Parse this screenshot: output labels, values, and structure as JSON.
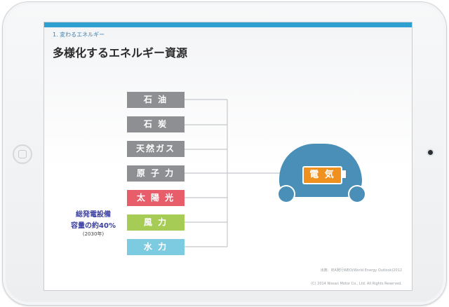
{
  "slide": {
    "section": "1. 変わるエネルギー",
    "title": "多様化するエネルギー資源"
  },
  "energy_sources": [
    {
      "label": "石 油",
      "color": "#8d8f92"
    },
    {
      "label": "石 炭",
      "color": "#8d8f92"
    },
    {
      "label": "天然ガス",
      "color": "#8d8f92"
    },
    {
      "label": "原 子 力",
      "color": "#8d8f92"
    },
    {
      "label": "太 陽 光",
      "color": "#e85d6a"
    },
    {
      "label": "風 力",
      "color": "#a7cc55"
    },
    {
      "label": "水 力",
      "color": "#7ccbe1"
    }
  ],
  "target": {
    "label": "電 気",
    "accent": "#f0901e",
    "car_color": "#4a8fb8"
  },
  "capacity_note": {
    "line1": "総発電設備",
    "line2": "容量の約40%",
    "line3": "(2030年)"
  },
  "footer": {
    "source": "出典：IEA発行WEO(World Energy Outlook)2012",
    "copyright": "(C) 2014 Nissan Motor Co., Ltd. All Rights Reserved."
  },
  "colors": {
    "topbar": "#2f9fd0",
    "title": "#2b2b2b"
  }
}
